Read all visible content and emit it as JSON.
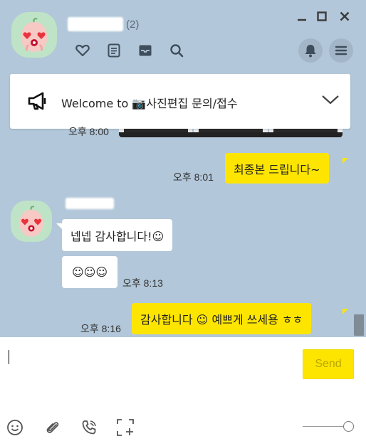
{
  "header": {
    "member_count": "(2)"
  },
  "notice": {
    "text": "Welcome to 📷사진편집 문의/접수"
  },
  "messages": [
    {
      "time": "오후 8:00"
    },
    {
      "time": "오후 8:01",
      "text": "최종본 드립니다~"
    },
    {
      "text": "넵넵 감사합니다!☺"
    },
    {
      "time": "오후 8:13",
      "text": "☺☺☺"
    },
    {
      "time": "오후 8:16",
      "text": "감사합니다 ☺ 예쁘게 쓰세용 ㅎㅎ"
    }
  ],
  "composer": {
    "send_label": "Send"
  },
  "colors": {
    "chat_bg": "#b2c7d9",
    "my_bubble": "#fee500",
    "other_bubble": "#ffffff",
    "avatar_bg": "#bfe3c7"
  },
  "icons": [
    "heart-icon",
    "notes-icon",
    "inbox-icon",
    "search-icon",
    "bell-icon",
    "menu-icon",
    "megaphone-icon",
    "chevron-down-icon",
    "emoji-icon",
    "paperclip-icon",
    "phone-icon",
    "capture-icon"
  ]
}
